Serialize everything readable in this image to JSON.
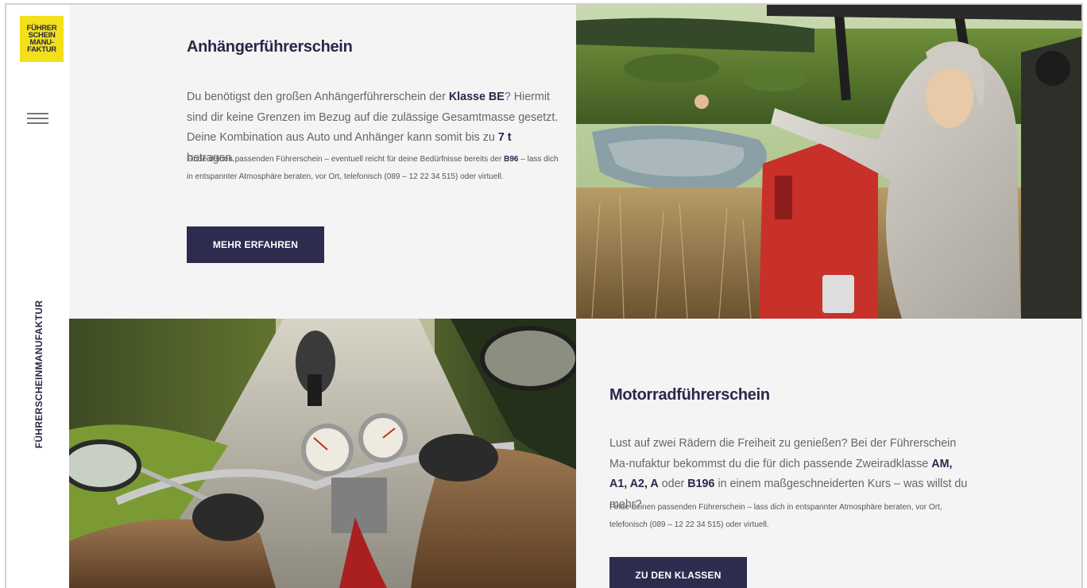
{
  "logo": {
    "lines": [
      "FÜHRER",
      "SCHEIN",
      "MANU-",
      "FAKTUR"
    ]
  },
  "sidebar": {
    "brand_vertical": "FÜHRERSCHEINMANUFAKTUR"
  },
  "section1": {
    "title": "Anhängerführerschein",
    "lead": {
      "t1": "Du benötigst den großen Anhängerführerschein der ",
      "b1": "Klasse BE",
      "t2": "? Hiermit sind dir keine Grenzen im Bezug auf die zulässige Gesamtmasse gesetzt. Deine Kombination aus Auto und Anhänger kann somit bis zu ",
      "b2": "7 t",
      "t3": " betragen."
    },
    "small": {
      "t1": "Finde deinen passenden Führerschein – eventuell reicht für deine Bedürfnisse bereits der ",
      "b1": "B96",
      "t2": " – lass dich in entspannter Atmosphäre beraten, vor Ort, telefonisch (089 – 12 22 34 515) oder virtuell."
    },
    "button": "MEHR ERFAHREN"
  },
  "section2": {
    "title": "Motorradführerschein",
    "lead": {
      "t1": "Lust auf zwei Rädern die Freiheit zu genießen? Bei der Führerschein Ma-nufaktur bekommst du die für dich passende Zweiradklasse ",
      "b1": "AM, A1, A2, A",
      "t2": " oder ",
      "b2": "B196",
      "t3": " in einem maßgeschneiderten Kurs – was willst du mehr?"
    },
    "small": {
      "t1": "Finde deinen passenden Führerschein – lass dich in entspannter Atmosphäre beraten, vor Ort, telefonisch (089 – 12 22 34 515) oder virtuell."
    },
    "button": "ZU DEN KLASSEN"
  },
  "colors": {
    "navy": "#2d2b4e",
    "panel_bg": "#f4f4f5",
    "logo_yellow": "#f2e01a",
    "logo_cyan": "#7fd3ea"
  },
  "icons": {
    "menu": "hamburger-icon"
  }
}
